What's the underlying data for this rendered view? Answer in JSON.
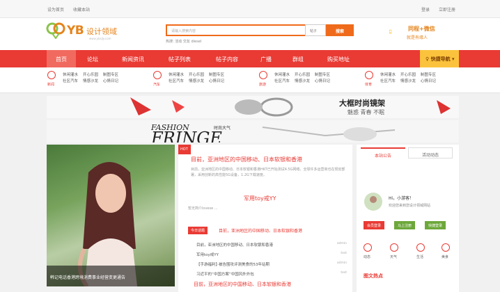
{
  "topbar": {
    "left1": "设为首页",
    "left2": "收藏本站",
    "right1": "登录",
    "right2": "立即注册"
  },
  "logo": {
    "text": "YB",
    "sub": "设计领域",
    "url": "www.ybsjly.com"
  },
  "search": {
    "placeholder": "请输入搜索内容",
    "type": "帖子",
    "button": "搜索",
    "hot": "热搜: 活动 交友 diesel"
  },
  "app": {
    "title": "同程+微信",
    "sub": "就是有缘人"
  },
  "nav": {
    "items": [
      "首页",
      "论坛",
      "新闻资讯",
      "帖子列表",
      "帖子内容",
      "广播",
      "群组",
      "购买地址"
    ],
    "login": "快捷导航"
  },
  "subnav": {
    "groups": [
      {
        "icon": "新闻",
        "lines": [
          [
            "休闲灌水",
            "开心乐园",
            "制图专区"
          ],
          [
            "社区汽车",
            "情感沙龙",
            "心情日记"
          ]
        ]
      },
      {
        "icon": "汽车",
        "lines": [
          [
            "休闲灌水",
            "开心乐园",
            "制图专区"
          ],
          [
            "社区汽车",
            "情感沙龙",
            "心情日记"
          ]
        ]
      },
      {
        "icon": "旅游",
        "lines": [
          [
            "休闲灌水",
            "开心乐园",
            "制图专区"
          ],
          [
            "社区汽车",
            "情感沙龙",
            "心情日记"
          ]
        ]
      },
      {
        "icon": "体育",
        "lines": [
          [
            "休闲灌水",
            "开心乐园",
            "制图专区"
          ],
          [
            "社区汽车",
            "情感沙龙",
            "心情日记"
          ]
        ]
      }
    ]
  },
  "banner1": {
    "title": "大框时尚镜架",
    "sub": "魅惑 青春 不眠"
  },
  "banner2": {
    "title": "FASHION",
    "sub": "FRINGE",
    "tag": "时尚大气"
  },
  "photo": {
    "caption": "韩记电话香港跨境消费事业经营变更通告"
  },
  "mid": {
    "hot_tag": "HOT",
    "headline": "目前，亚洲地区的中国移动、日本软银和香港",
    "para": "目前，亚洲地区的中国移动、日本软银和香港HKT已开始测试4.5G网络，全球许多运营商也在规划部署，采用创新的高性能5G设备，1.2G下载速度。",
    "subhead": "军用toy戒YY",
    "subpara": "暂无简介lovese ...",
    "today_tag": "今日话题",
    "today_line": "目前，亚洲地区的中国移动、日本软银和香港",
    "list": [
      {
        "text": "目前，亚洲地区的中国移动、日本软银和香港",
        "user": "admin"
      },
      {
        "text": "军用toy戒YY",
        "user": "test"
      },
      {
        "text": "【手游福利】·被告围攻评测美食的53年站期",
        "user": "admin"
      },
      {
        "text": "习近平的“中国方案”中国风外外包",
        "user": "test"
      }
    ],
    "bottom": "目前，亚洲地区的中国移动、日本软银和香港"
  },
  "right": {
    "tabs": [
      "本站公告",
      "活动动态"
    ],
    "greeting": "Hi，小游客！",
    "welcome": "欢迎您来到您设计领域网站",
    "buttons": [
      "会员登录",
      "马上注册",
      "快捷登录"
    ],
    "icons": [
      "动态",
      "天气",
      "生活",
      "美食"
    ],
    "section": "图文热点"
  },
  "colors": {
    "red": "#e93a34",
    "orange": "#ef6b1b",
    "yellow": "#fbc33d"
  }
}
